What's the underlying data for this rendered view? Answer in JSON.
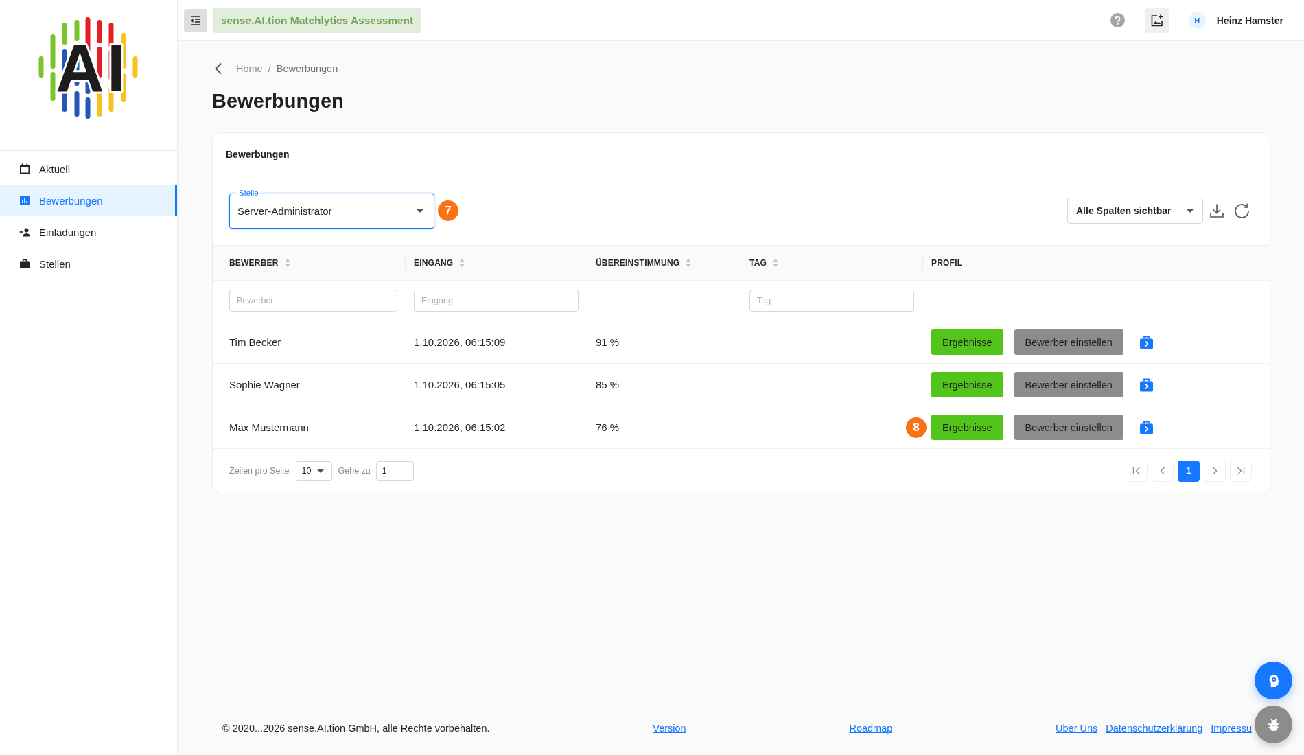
{
  "sidebar": {
    "logo_text": "AI",
    "items": [
      {
        "label": "Aktuell",
        "selected": false
      },
      {
        "label": "Bewerbungen",
        "selected": true
      },
      {
        "label": "Einladungen",
        "selected": false
      },
      {
        "label": "Stellen",
        "selected": false
      }
    ]
  },
  "header": {
    "app_title": "sense.AI.tion Matchlytics Assessment",
    "user": {
      "initial": "H",
      "name": "Heinz Hamster"
    }
  },
  "breadcrumb": {
    "items": [
      "Home",
      "Bewerbungen"
    ],
    "separator": "/"
  },
  "page_title": "Bewerbungen",
  "card": {
    "title": "Bewerbungen",
    "position_select": {
      "label": "Stelle",
      "value": "Server-Administrator",
      "focused": true,
      "step_marker": "7"
    },
    "columns_select": {
      "value": "Alle Spalten sichtbar"
    },
    "table": {
      "columns": [
        {
          "label": "BEWERBER",
          "sortable": true,
          "filter_placeholder": "Bewerber"
        },
        {
          "label": "EINGANG",
          "sortable": true,
          "filter_placeholder": "Eingang"
        },
        {
          "label": "ÜBEREINSTIMMUNG",
          "sortable": true
        },
        {
          "label": "TAG",
          "sortable": true,
          "filter_placeholder": "Tag"
        },
        {
          "label": "PROFIL",
          "sortable": false
        }
      ],
      "rows": [
        {
          "cells": [
            "Tim Becker",
            "1.10.2026, 06:15:09",
            "91 %"
          ],
          "actions": [
            {
              "label": "Ergebnisse",
              "kind": "success"
            },
            {
              "label": "Bewerber einstellen",
              "kind": "neutral"
            }
          ]
        },
        {
          "cells": [
            "Sophie Wagner",
            "1.10.2026, 06:15:05",
            "85 %"
          ],
          "actions": [
            {
              "label": "Ergebnisse",
              "kind": "success"
            },
            {
              "label": "Bewerber einstellen",
              "kind": "neutral"
            }
          ]
        },
        {
          "cells": [
            "Max Mustermann",
            "1.10.2026, 06:15:02",
            "76 %"
          ],
          "step_marker": "8",
          "actions": [
            {
              "label": "Ergebnisse",
              "kind": "success"
            },
            {
              "label": "Bewerber einstellen",
              "kind": "neutral"
            }
          ]
        }
      ]
    },
    "pagination": {
      "rows_per_page_label": "Zeilen pro Seite",
      "rows_per_page": "10",
      "goto_label": "Gehe zu",
      "goto_value": "1",
      "pages": [
        {
          "label": "1",
          "selected": true
        }
      ]
    }
  },
  "footer": {
    "copyright": "© 2020...2026 sense.AI.tion GmbH, alle Rechte vorbehalten.",
    "links": [
      "Version",
      "Roadmap"
    ],
    "legal_links": [
      "Über Uns",
      "Datenschutzerklärung",
      "Impressu"
    ]
  }
}
